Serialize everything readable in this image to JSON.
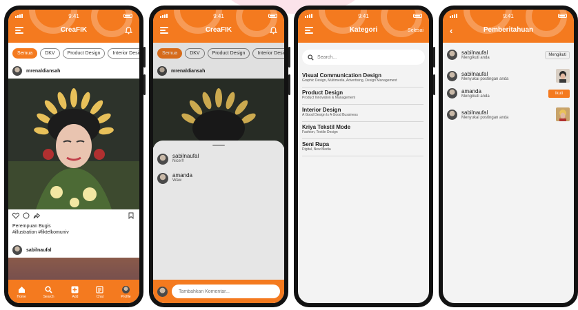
{
  "status": {
    "time": "9:41"
  },
  "screen1": {
    "title": "CreaFIK",
    "chips": [
      "Semua",
      "DKV",
      "Product Design",
      "Interior Design"
    ],
    "post": {
      "username": "mrenaldiansah",
      "caption_title": "Perempuan Bugis",
      "caption_tags": "#illustration #fiktelkomuniv"
    },
    "next_post_user": "sabilnaufal",
    "nav": [
      {
        "label": "Home",
        "icon": "home-icon"
      },
      {
        "label": "Search",
        "icon": "search-icon"
      },
      {
        "label": "Add",
        "icon": "add-icon"
      },
      {
        "label": "Chat",
        "icon": "chat-icon"
      },
      {
        "label": "Profile",
        "icon": "profile-icon"
      }
    ]
  },
  "screen2": {
    "title": "CreaFIK",
    "chips": [
      "Semua",
      "DKV",
      "Product Design",
      "Interior Design"
    ],
    "post_user": "mrenaldiansah",
    "comments": [
      {
        "name": "sabilnaufal",
        "text": "Nice!!!"
      },
      {
        "name": "amanda",
        "text": "Waw"
      }
    ],
    "comment_placeholder": "Tambahkan Komentar..."
  },
  "screen3": {
    "title": "Kategori",
    "action": "Selesai",
    "search_placeholder": "Search...",
    "categories": [
      {
        "title": "Visual Communication Design",
        "sub": "Graphic Design, Multimedia, Advertising, Design Management"
      },
      {
        "title": "Product Design",
        "sub": "Product Innovation & Management"
      },
      {
        "title": "Interior Design",
        "sub": "A Good Design Is A Good Bussiness"
      },
      {
        "title": "Kriya Tekstil Mode",
        "sub": "Fashion, Textile Design"
      },
      {
        "title": "Seni Rupa",
        "sub": "Digital, New Media"
      }
    ]
  },
  "screen4": {
    "title": "Pemberitahuan",
    "notifications": [
      {
        "name": "sabilnaufal",
        "action": "Mengikuti anda",
        "button": "Mengikuti"
      },
      {
        "name": "sabilnaufal",
        "action": "Menyukai postingan anda"
      },
      {
        "name": "amanda",
        "action": "Mengikuti anda",
        "button": "Ikuti"
      },
      {
        "name": "sabilnaufal",
        "action": "Menyukai postingan anda"
      }
    ]
  },
  "colors": {
    "accent": "#f47a1f",
    "background": "#ffffff",
    "sheet": "#e6e6e6"
  }
}
